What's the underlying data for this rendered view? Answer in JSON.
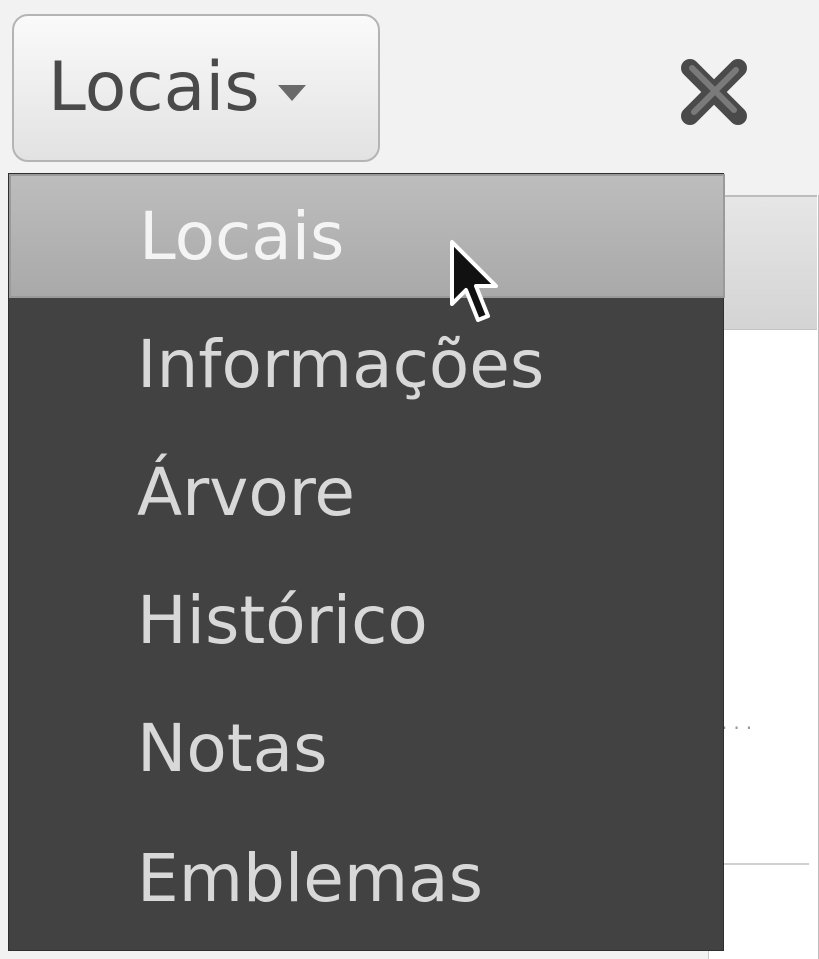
{
  "header": {
    "view_selector_label": "Locais",
    "caret_icon": "chevron-down-icon",
    "close_icon": "close-icon"
  },
  "menu": {
    "items": [
      {
        "label": "Locais",
        "selected": true
      },
      {
        "label": "Informações",
        "selected": false
      },
      {
        "label": "Árvore",
        "selected": false
      },
      {
        "label": "Histórico",
        "selected": false
      },
      {
        "label": "Notas",
        "selected": false
      },
      {
        "label": "Emblemas",
        "selected": false
      }
    ]
  },
  "panel": {
    "ellipsis": "..."
  },
  "colors": {
    "menu_background": "#424242",
    "menu_selected": "#b3b3b3",
    "menu_text": "#d8d8d8",
    "close_icon": "#4a4a4a"
  }
}
